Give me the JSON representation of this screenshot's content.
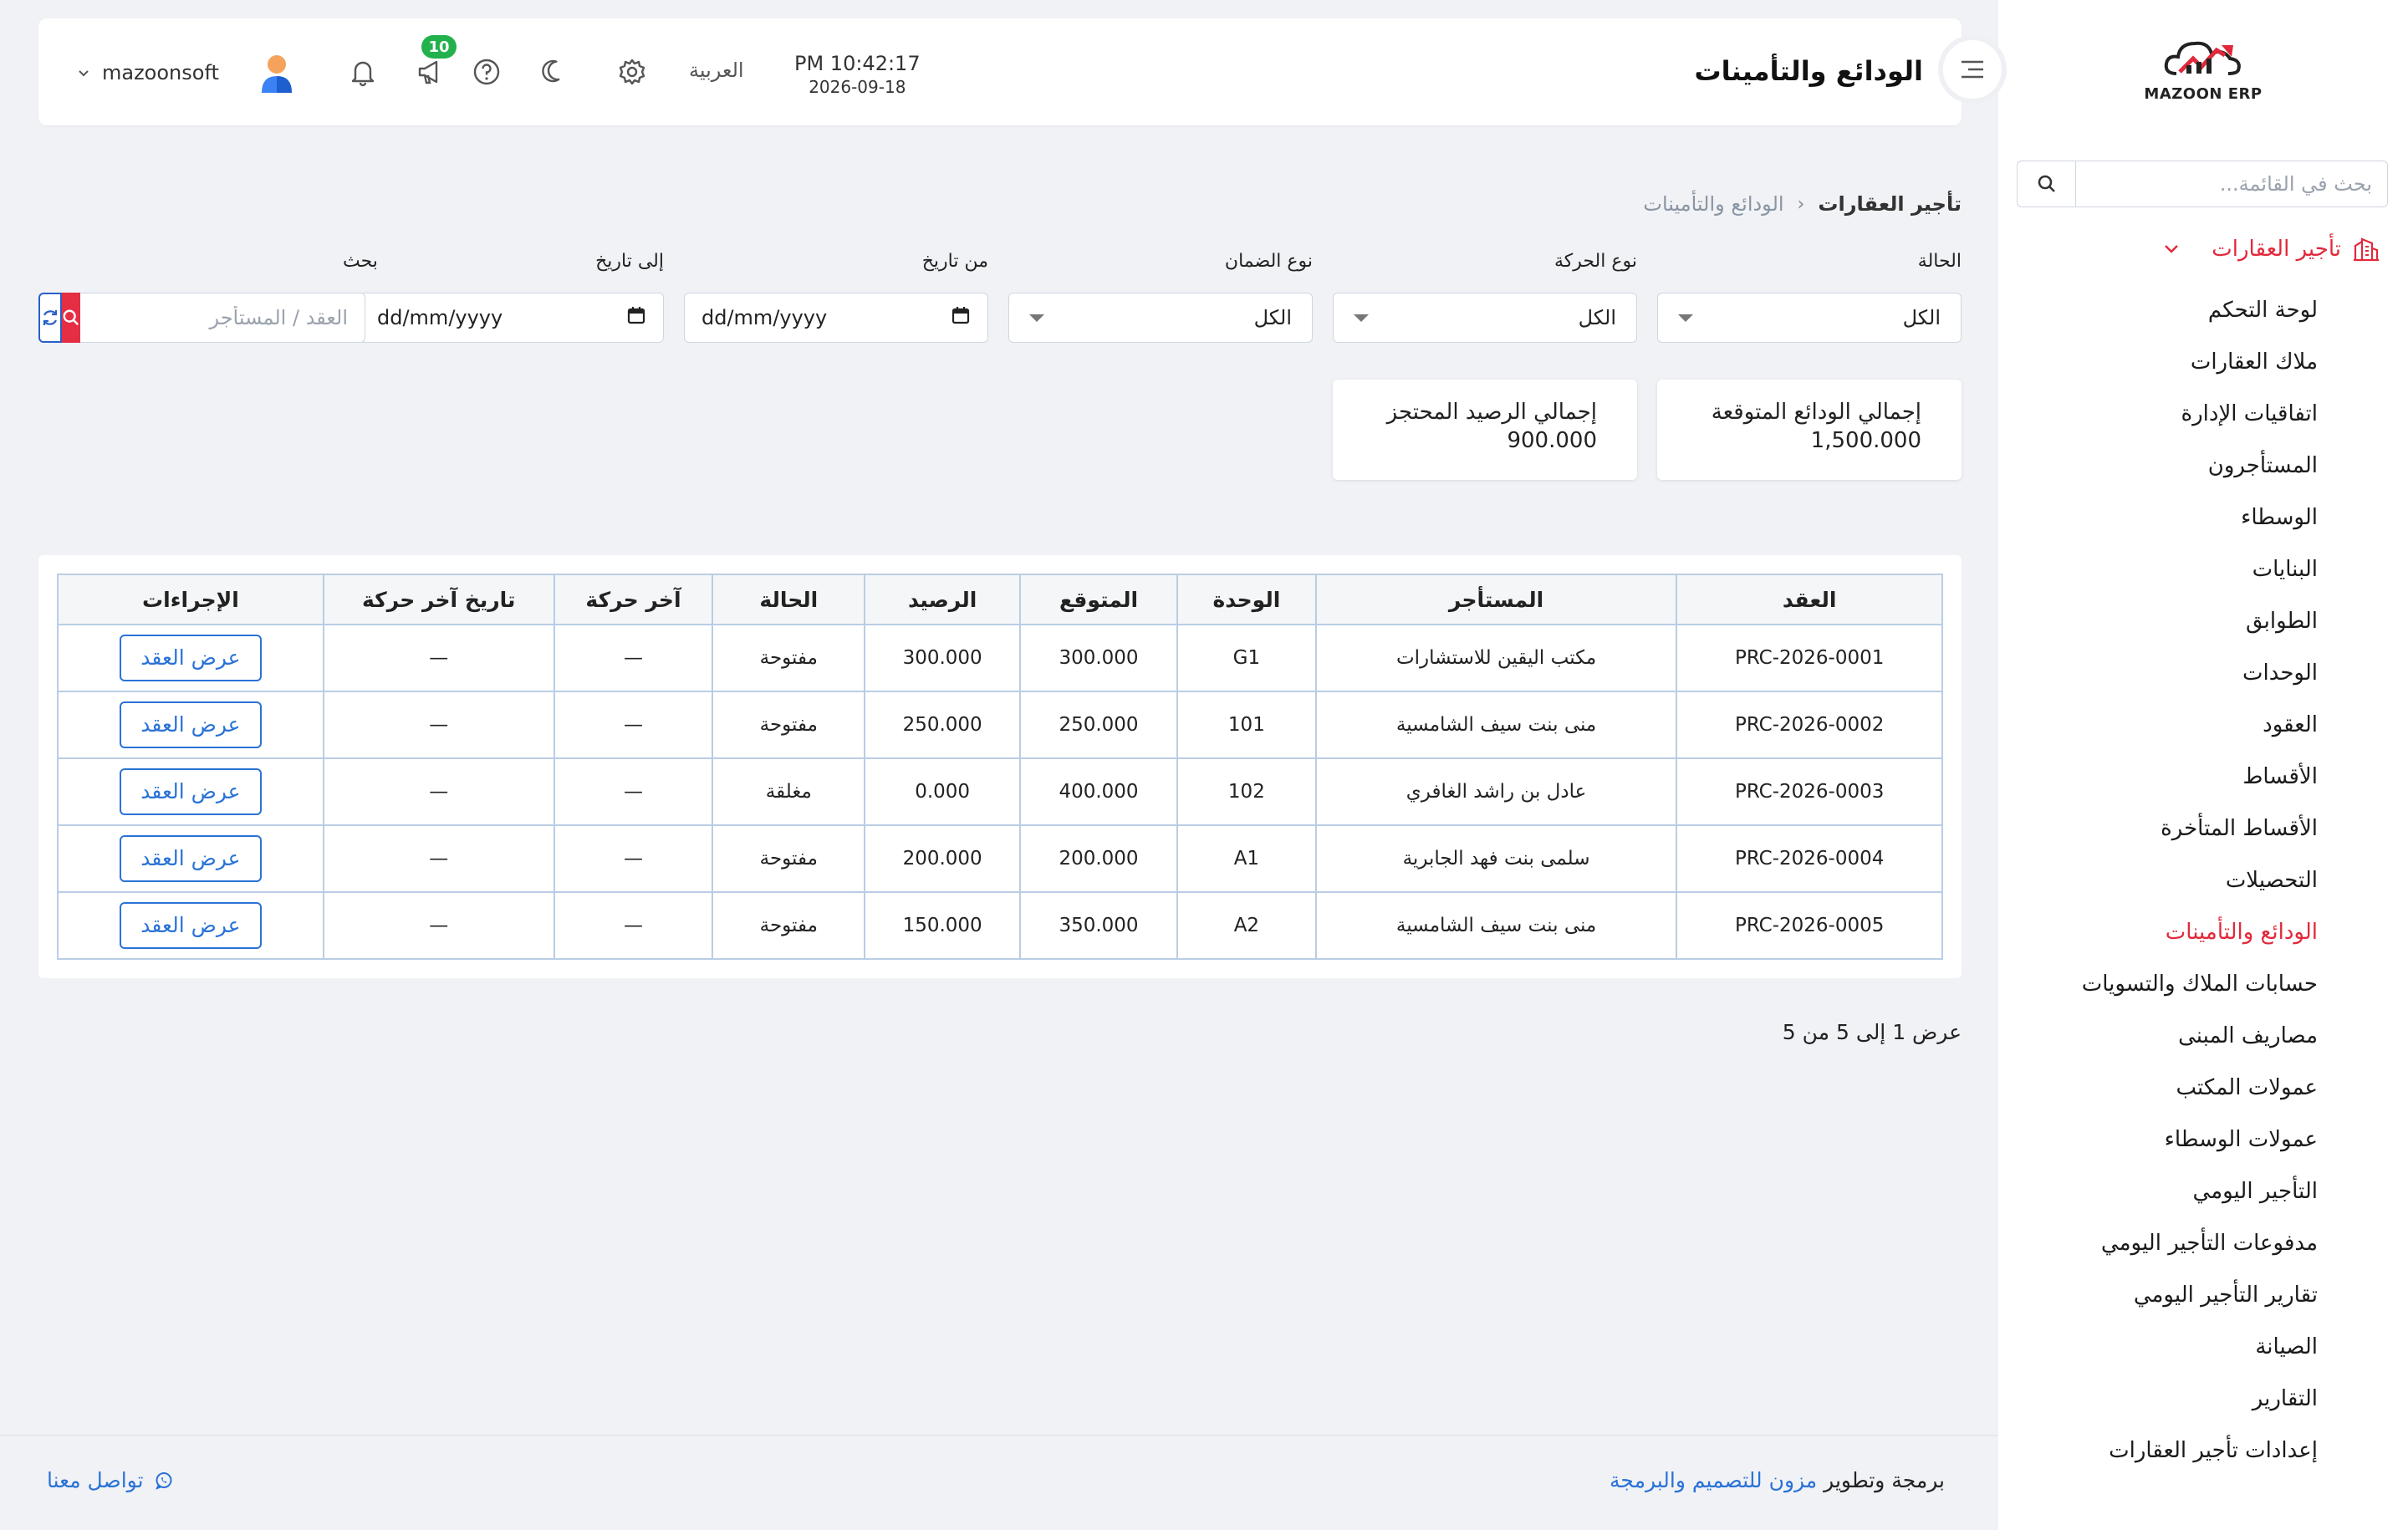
{
  "sidebar": {
    "logo_text": "MAZOON ERP",
    "search_placeholder": "بحث في القائمة...",
    "group_label": "تأجير العقارات",
    "items": [
      {
        "label": "لوحة التحكم"
      },
      {
        "label": "ملاك العقارات"
      },
      {
        "label": "اتفاقيات الإدارة"
      },
      {
        "label": "المستأجرون"
      },
      {
        "label": "الوسطاء"
      },
      {
        "label": "البنايات"
      },
      {
        "label": "الطوابق"
      },
      {
        "label": "الوحدات"
      },
      {
        "label": "العقود"
      },
      {
        "label": "الأقساط"
      },
      {
        "label": "الأقساط المتأخرة"
      },
      {
        "label": "التحصيلات"
      },
      {
        "label": "الودائع والتأمينات",
        "active": true
      },
      {
        "label": "حسابات الملاك والتسويات"
      },
      {
        "label": "مصاريف المبنى"
      },
      {
        "label": "عمولات المكتب"
      },
      {
        "label": "عمولات الوسطاء"
      },
      {
        "label": "التأجير اليومي"
      },
      {
        "label": "مدفوعات التأجير اليومي"
      },
      {
        "label": "تقارير التأجير اليومي"
      },
      {
        "label": "الصيانة"
      },
      {
        "label": "التقارير"
      },
      {
        "label": "إعدادات تأجير العقارات"
      }
    ]
  },
  "header": {
    "title": "الودائع والتأمينات",
    "time": "PM 10:42:17",
    "date": "2026-09-18",
    "language": "العربية",
    "notification_count": "10",
    "username": "mazoonsoft"
  },
  "breadcrumb": {
    "root": "تأجير العقارات",
    "current": "الودائع والتأمينات"
  },
  "filters": {
    "status": {
      "label": "الحالة",
      "value": "الكل"
    },
    "movement_type": {
      "label": "نوع الحركة",
      "value": "الكل"
    },
    "guarantee_type": {
      "label": "نوع الضمان",
      "value": "الكل"
    },
    "from_date": {
      "label": "من تاريخ",
      "value": "dd/mm/yyyy"
    },
    "to_date": {
      "label": "إلى تاريخ",
      "value": "dd/mm/yyyy"
    },
    "search": {
      "label": "بحث",
      "placeholder": "العقد / المستأجر"
    }
  },
  "summary": {
    "expected_label": "إجمالي الودائع المتوقعة",
    "expected_value": "1,500.000",
    "held_label": "إجمالي الرصيد المحتجز",
    "held_value": "900.000"
  },
  "table": {
    "headers": {
      "contract": "العقد",
      "tenant": "المستأجر",
      "unit": "الوحدة",
      "expected": "المتوقع",
      "balance": "الرصيد",
      "status": "الحالة",
      "last_movement": "آخر حركة",
      "last_movement_date": "تاريخ آخر حركة",
      "actions": "الإجراءات"
    },
    "view_button_label": "عرض العقد",
    "rows": [
      {
        "contract": "PRC-2026-0001",
        "tenant": "مكتب اليقين للاستشارات",
        "unit": "G1",
        "expected": "300.000",
        "balance": "300.000",
        "status": "مفتوحة",
        "last_movement": "—",
        "last_movement_date": "—"
      },
      {
        "contract": "PRC-2026-0002",
        "tenant": "منى بنت سيف الشامسية",
        "unit": "101",
        "expected": "250.000",
        "balance": "250.000",
        "status": "مفتوحة",
        "last_movement": "—",
        "last_movement_date": "—"
      },
      {
        "contract": "PRC-2026-0003",
        "tenant": "عادل بن راشد الغافري",
        "unit": "102",
        "expected": "400.000",
        "balance": "0.000",
        "status": "مغلقة",
        "last_movement": "—",
        "last_movement_date": "—"
      },
      {
        "contract": "PRC-2026-0004",
        "tenant": "سلمى بنت فهد الجابرية",
        "unit": "A1",
        "expected": "200.000",
        "balance": "200.000",
        "status": "مفتوحة",
        "last_movement": "—",
        "last_movement_date": "—"
      },
      {
        "contract": "PRC-2026-0005",
        "tenant": "منى بنت سيف الشامسية",
        "unit": "A2",
        "expected": "350.000",
        "balance": "150.000",
        "status": "مفتوحة",
        "last_movement": "—",
        "last_movement_date": "—"
      }
    ]
  },
  "pagination": {
    "text": "عرض 1 إلى 5 من 5"
  },
  "footer": {
    "credit_prefix": "برمجة وتطوير",
    "credit_brand": "مزون للتصميم والبرمجة",
    "contact": "تواصل معنا"
  },
  "colors": {
    "accent_red": "#e1293b",
    "primary_blue": "#2a72d6",
    "badge_green": "#22b14c"
  }
}
